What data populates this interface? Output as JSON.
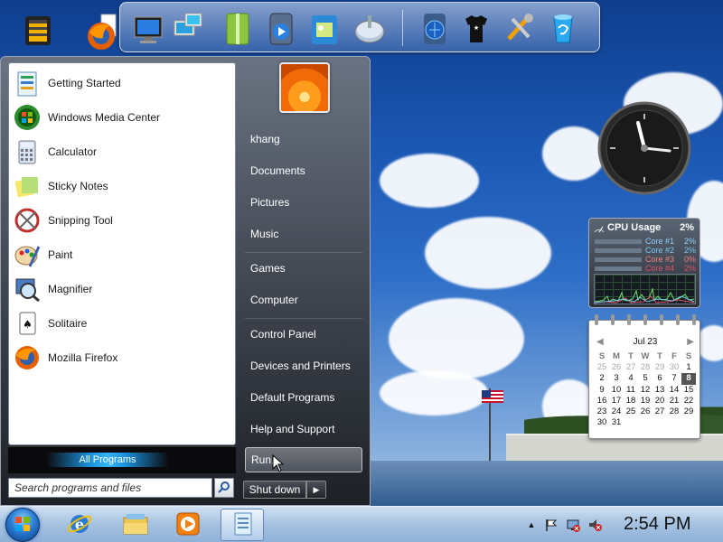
{
  "start_menu": {
    "programs": [
      {
        "label": "Getting Started",
        "icon": "getting-started-icon"
      },
      {
        "label": "Windows Media Center",
        "icon": "media-center-icon"
      },
      {
        "label": "Calculator",
        "icon": "calculator-icon"
      },
      {
        "label": "Sticky Notes",
        "icon": "sticky-notes-icon"
      },
      {
        "label": "Snipping Tool",
        "icon": "snipping-tool-icon"
      },
      {
        "label": "Paint",
        "icon": "paint-icon"
      },
      {
        "label": "Magnifier",
        "icon": "magnifier-icon"
      },
      {
        "label": "Solitaire",
        "icon": "solitaire-icon"
      },
      {
        "label": "Mozilla Firefox",
        "icon": "firefox-icon"
      }
    ],
    "all_programs_label": "All Programs",
    "search_placeholder": "Search programs and files",
    "right_items": [
      "khang",
      "Documents",
      "Pictures",
      "Music",
      "Games",
      "Computer",
      "Control Panel",
      "Devices and Printers",
      "Default Programs",
      "Help and Support",
      "Run..."
    ],
    "shutdown_label": "Shut down"
  },
  "cpu_gadget": {
    "title": "CPU Usage",
    "total": "2%",
    "cores": [
      {
        "name": "Core #1",
        "value": "2%",
        "color": "#8fd0ff"
      },
      {
        "name": "Core #2",
        "value": "2%",
        "color": "#7ec6f0"
      },
      {
        "name": "Core #3",
        "value": "0%",
        "color": "#f08080"
      },
      {
        "name": "Core #4",
        "value": "2%",
        "color": "#e0506a"
      }
    ]
  },
  "calendar": {
    "month_label": "Jul 23",
    "days_of_week": [
      "S",
      "M",
      "T",
      "W",
      "T",
      "F",
      "S"
    ],
    "weeks": [
      [
        "25",
        "26",
        "27",
        "28",
        "29",
        "30",
        "1"
      ],
      [
        "2",
        "3",
        "4",
        "5",
        "6",
        "7",
        "8"
      ],
      [
        "9",
        "10",
        "11",
        "12",
        "13",
        "14",
        "15"
      ],
      [
        "16",
        "17",
        "18",
        "19",
        "20",
        "21",
        "22"
      ],
      [
        "23",
        "24",
        "25",
        "26",
        "27",
        "28",
        "29"
      ],
      [
        "30",
        "31",
        "",
        "",
        "",
        "",
        ""
      ]
    ],
    "today": "8"
  },
  "taskbar": {
    "time": "2:54 PM",
    "pinned": [
      "start-orb",
      "internet-explorer-icon",
      "windows-explorer-icon",
      "media-player-icon",
      "notebook-app-icon"
    ]
  },
  "dock": {
    "icons": [
      "firefox-icon",
      "computer-icon",
      "network-icon",
      "zip-folder-icon",
      "media-player-icon",
      "pictures-folder-icon",
      "disk-icon",
      "media-globe-icon",
      "tshirt-icon",
      "tools-icon",
      "recycle-bin-icon"
    ]
  }
}
